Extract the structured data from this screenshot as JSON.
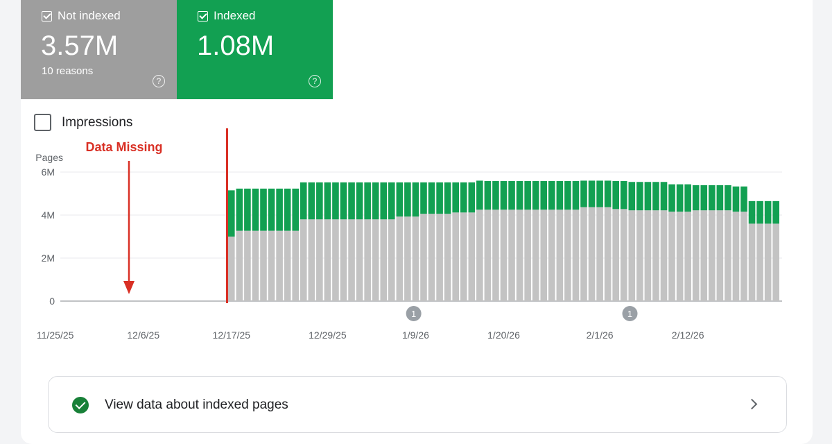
{
  "tiles": {
    "not_indexed": {
      "label": "Not indexed",
      "value": "3.57M",
      "sub": "10 reasons",
      "color": "#9e9e9e"
    },
    "indexed": {
      "label": "Indexed",
      "value": "1.08M",
      "color": "#12a052"
    }
  },
  "impressions": {
    "label": "Impressions",
    "checked": false
  },
  "footer": {
    "link_text": "View data about indexed pages"
  },
  "chart_data": {
    "type": "bar",
    "stacked": true,
    "ylabel": "Pages",
    "y_ticks": [
      "0",
      "2M",
      "4M",
      "6M"
    ],
    "ylim": [
      0,
      6000000
    ],
    "x_tick_labels": [
      "11/25/25",
      "12/6/25",
      "12/17/25",
      "12/29/25",
      "1/9/26",
      "1/20/26",
      "2/1/26",
      "2/12/26"
    ],
    "x_start": "11/25/25",
    "x_end": "2/22/26",
    "x_values_are_day_offsets": true,
    "data_start_day": 22,
    "not_indexed_values": [
      3000000,
      3270000,
      3270000,
      3270000,
      3270000,
      3270000,
      3270000,
      3270000,
      3270000,
      3800000,
      3800000,
      3800000,
      3800000,
      3800000,
      3800000,
      3800000,
      3800000,
      3800000,
      3800000,
      3800000,
      3800000,
      3930000,
      3930000,
      3930000,
      4060000,
      4060000,
      4060000,
      4060000,
      4120000,
      4120000,
      4120000,
      4250000,
      4250000,
      4250000,
      4250000,
      4250000,
      4250000,
      4250000,
      4250000,
      4250000,
      4250000,
      4250000,
      4250000,
      4250000,
      4370000,
      4370000,
      4370000,
      4370000,
      4280000,
      4280000,
      4220000,
      4220000,
      4220000,
      4220000,
      4220000,
      4160000,
      4160000,
      4160000,
      4220000,
      4220000,
      4220000,
      4220000,
      4220000,
      4160000,
      4160000,
      3600000,
      3600000,
      3600000,
      3600000
    ],
    "indexed_values": [
      2150000,
      1960000,
      1960000,
      1960000,
      1960000,
      1960000,
      1960000,
      1960000,
      1960000,
      1720000,
      1720000,
      1720000,
      1720000,
      1720000,
      1720000,
      1720000,
      1720000,
      1720000,
      1720000,
      1720000,
      1720000,
      1590000,
      1590000,
      1590000,
      1460000,
      1460000,
      1460000,
      1460000,
      1400000,
      1400000,
      1400000,
      1350000,
      1330000,
      1330000,
      1330000,
      1330000,
      1330000,
      1330000,
      1330000,
      1330000,
      1330000,
      1330000,
      1330000,
      1330000,
      1230000,
      1230000,
      1230000,
      1230000,
      1300000,
      1300000,
      1320000,
      1320000,
      1320000,
      1320000,
      1320000,
      1270000,
      1270000,
      1270000,
      1170000,
      1170000,
      1170000,
      1170000,
      1170000,
      1170000,
      1170000,
      1050000,
      1050000,
      1050000,
      1050000
    ],
    "series": [
      {
        "name": "Not indexed",
        "color": "#c3c3c3"
      },
      {
        "name": "Indexed",
        "color": "#12a052"
      }
    ],
    "annotations": [
      {
        "text": "Data Missing",
        "color": "#d93025"
      },
      {
        "text": "1",
        "day": 45
      },
      {
        "text": "1",
        "day": 72
      }
    ],
    "grid": true
  }
}
